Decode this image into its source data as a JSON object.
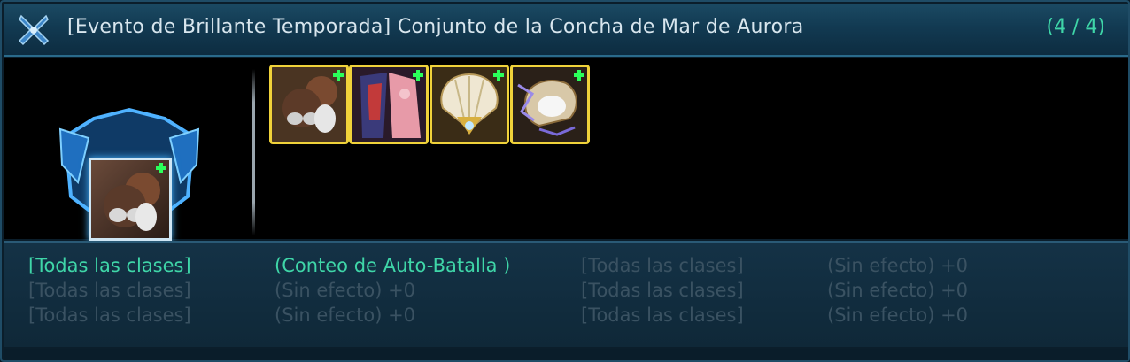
{
  "header": {
    "title": "[Evento de Brillante Temporada] Conjunto de la Concha de Mar de Aurora",
    "count": "(4 / 4)",
    "emblem_icon": "crossed-swords-emblem"
  },
  "set_badge": {
    "icon": "costume-badge-icon"
  },
  "items": [
    {
      "name": "hair-accessory-item",
      "icon": "hair-glasses-icon"
    },
    {
      "name": "outfit-item",
      "icon": "outfit-icon"
    },
    {
      "name": "shell-crown-item",
      "icon": "shell-crown-icon"
    },
    {
      "name": "pearl-shell-item",
      "icon": "pearl-shell-icon"
    }
  ],
  "stats": [
    [
      {
        "text": "[Todas las clases]",
        "active": true
      },
      {
        "text": "(Conteo de Auto-Batalla )",
        "active": true
      },
      {
        "text": "[Todas las clases]",
        "active": false
      },
      {
        "text": "(Sin efecto) +0",
        "active": false
      }
    ],
    [
      {
        "text": "[Todas las clases]",
        "active": false
      },
      {
        "text": "(Sin efecto) +0",
        "active": false
      },
      {
        "text": "[Todas las clases]",
        "active": false
      },
      {
        "text": "(Sin efecto) +0",
        "active": false
      }
    ],
    [
      {
        "text": "[Todas las clases]",
        "active": false
      },
      {
        "text": "(Sin efecto) +0",
        "active": false
      },
      {
        "text": "[Todas las clases]",
        "active": false
      },
      {
        "text": "(Sin efecto) +0",
        "active": false
      }
    ]
  ],
  "colors": {
    "active_text": "#3fd6a8",
    "inactive_text": "#3a5262",
    "slot_border": "#f0d23a",
    "plus": "#2bff5a"
  }
}
